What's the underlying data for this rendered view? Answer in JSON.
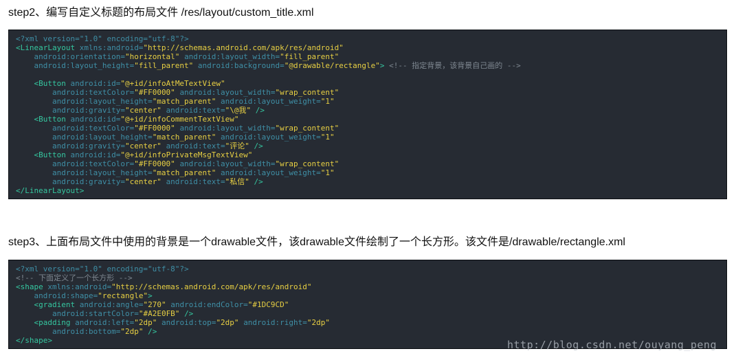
{
  "step2_heading": "step2、编写自定义标题的布局文件 /res/layout/custom_title.xml",
  "step3_heading": "step3、上面布局文件中使用的背景是一个drawable文件，该drawable文件绘制了一个长方形。该文件是/drawable/rectangle.xml",
  "code_block_1": [
    [
      [
        "pi",
        "<?xml version=\"1.0\" encoding=\"utf-8\"?>"
      ]
    ],
    [
      [
        "tag",
        "<LinearLayout "
      ],
      [
        "attr",
        "xmlns:android="
      ],
      [
        "val",
        "\"http://schemas.android.com/apk/res/android\""
      ]
    ],
    [
      [
        "plain",
        "    "
      ],
      [
        "attr",
        "android:orientation="
      ],
      [
        "val",
        "\"horizontal\""
      ],
      [
        "plain",
        " "
      ],
      [
        "attr",
        "android:layout_width="
      ],
      [
        "val",
        "\"fill_parent\""
      ]
    ],
    [
      [
        "plain",
        "    "
      ],
      [
        "attr",
        "android:layout_height="
      ],
      [
        "val",
        "\"fill_parent\""
      ],
      [
        "plain",
        " "
      ],
      [
        "attr",
        "android:background="
      ],
      [
        "val",
        "\"@drawable/rectangle\""
      ],
      [
        "tag",
        ">"
      ],
      [
        "plain",
        " "
      ],
      [
        "comment",
        "<!-- 指定背景，该背景自己画的 -->"
      ]
    ],
    [],
    [
      [
        "plain",
        "    "
      ],
      [
        "tag",
        "<Button "
      ],
      [
        "attr",
        "android:id="
      ],
      [
        "val",
        "\"@+id/infoAtMeTextView\""
      ]
    ],
    [
      [
        "plain",
        "        "
      ],
      [
        "attr",
        "android:textColor="
      ],
      [
        "val",
        "\"#FF0000\""
      ],
      [
        "plain",
        " "
      ],
      [
        "attr",
        "android:layout_width="
      ],
      [
        "val",
        "\"wrap_content\""
      ]
    ],
    [
      [
        "plain",
        "        "
      ],
      [
        "attr",
        "android:layout_height="
      ],
      [
        "val",
        "\"match_parent\""
      ],
      [
        "plain",
        " "
      ],
      [
        "attr",
        "android:layout_weight="
      ],
      [
        "val",
        "\"1\""
      ]
    ],
    [
      [
        "plain",
        "        "
      ],
      [
        "attr",
        "android:gravity="
      ],
      [
        "val",
        "\"center\""
      ],
      [
        "plain",
        " "
      ],
      [
        "attr",
        "android:text="
      ],
      [
        "val",
        "\"\\@我\""
      ],
      [
        "plain",
        " "
      ],
      [
        "tag",
        "/>"
      ]
    ],
    [
      [
        "plain",
        "    "
      ],
      [
        "tag",
        "<Button "
      ],
      [
        "attr",
        "android:id="
      ],
      [
        "val",
        "\"@+id/infoCommentTextView\""
      ]
    ],
    [
      [
        "plain",
        "        "
      ],
      [
        "attr",
        "android:textColor="
      ],
      [
        "val",
        "\"#FF0000\""
      ],
      [
        "plain",
        " "
      ],
      [
        "attr",
        "android:layout_width="
      ],
      [
        "val",
        "\"wrap_content\""
      ]
    ],
    [
      [
        "plain",
        "        "
      ],
      [
        "attr",
        "android:layout_height="
      ],
      [
        "val",
        "\"match_parent\""
      ],
      [
        "plain",
        " "
      ],
      [
        "attr",
        "android:layout_weight="
      ],
      [
        "val",
        "\"1\""
      ]
    ],
    [
      [
        "plain",
        "        "
      ],
      [
        "attr",
        "android:gravity="
      ],
      [
        "val",
        "\"center\""
      ],
      [
        "plain",
        " "
      ],
      [
        "attr",
        "android:text="
      ],
      [
        "val",
        "\"评论\""
      ],
      [
        "plain",
        " "
      ],
      [
        "tag",
        "/>"
      ]
    ],
    [
      [
        "plain",
        "    "
      ],
      [
        "tag",
        "<Button "
      ],
      [
        "attr",
        "android:id="
      ],
      [
        "val",
        "\"@+id/infoPrivateMsgTextView\""
      ]
    ],
    [
      [
        "plain",
        "        "
      ],
      [
        "attr",
        "android:textColor="
      ],
      [
        "val",
        "\"#FF0000\""
      ],
      [
        "plain",
        " "
      ],
      [
        "attr",
        "android:layout_width="
      ],
      [
        "val",
        "\"wrap_content\""
      ]
    ],
    [
      [
        "plain",
        "        "
      ],
      [
        "attr",
        "android:layout_height="
      ],
      [
        "val",
        "\"match_parent\""
      ],
      [
        "plain",
        " "
      ],
      [
        "attr",
        "android:layout_weight="
      ],
      [
        "val",
        "\"1\""
      ]
    ],
    [
      [
        "plain",
        "        "
      ],
      [
        "attr",
        "android:gravity="
      ],
      [
        "val",
        "\"center\""
      ],
      [
        "plain",
        " "
      ],
      [
        "attr",
        "android:text="
      ],
      [
        "val",
        "\"私信\""
      ],
      [
        "plain",
        " "
      ],
      [
        "tag",
        "/>"
      ]
    ],
    [
      [
        "tag",
        "</LinearLayout>"
      ]
    ]
  ],
  "code_block_2": [
    [
      [
        "pi",
        "<?xml version=\"1.0\" encoding=\"utf-8\"?>"
      ]
    ],
    [
      [
        "comment",
        "<!-- 下面定义了一个长方形 -->"
      ]
    ],
    [
      [
        "tag",
        "<shape "
      ],
      [
        "attr",
        "xmlns:android="
      ],
      [
        "val",
        "\"http://schemas.android.com/apk/res/android\""
      ]
    ],
    [
      [
        "plain",
        "    "
      ],
      [
        "attr",
        "android:shape="
      ],
      [
        "val",
        "\"rectangle\""
      ],
      [
        "tag",
        ">"
      ]
    ],
    [
      [
        "plain",
        "    "
      ],
      [
        "tag",
        "<gradient "
      ],
      [
        "attr",
        "android:angle="
      ],
      [
        "val",
        "\"270\""
      ],
      [
        "plain",
        " "
      ],
      [
        "attr",
        "android:endColor="
      ],
      [
        "val",
        "\"#1DC9CD\""
      ]
    ],
    [
      [
        "plain",
        "        "
      ],
      [
        "attr",
        "android:startColor="
      ],
      [
        "val",
        "\"#A2E0FB\""
      ],
      [
        "plain",
        " "
      ],
      [
        "tag",
        "/>"
      ]
    ],
    [
      [
        "plain",
        "    "
      ],
      [
        "tag",
        "<padding "
      ],
      [
        "attr",
        "android:left="
      ],
      [
        "val",
        "\"2dp\""
      ],
      [
        "plain",
        " "
      ],
      [
        "attr",
        "android:top="
      ],
      [
        "val",
        "\"2dp\""
      ],
      [
        "plain",
        " "
      ],
      [
        "attr",
        "android:right="
      ],
      [
        "val",
        "\"2dp\""
      ]
    ],
    [
      [
        "plain",
        "        "
      ],
      [
        "attr",
        "android:bottom="
      ],
      [
        "val",
        "\"2dp\""
      ],
      [
        "plain",
        " "
      ],
      [
        "tag",
        "/>"
      ]
    ],
    [
      [
        "tag",
        "</shape>"
      ]
    ]
  ],
  "watermark": "http://blog.csdn.net/ouyang_peng",
  "colors": {
    "code_background": "#262b33",
    "tag": "#35c7a0",
    "attribute": "#3f8fa6",
    "value": "#e7cf43",
    "comment": "#7e8790"
  }
}
